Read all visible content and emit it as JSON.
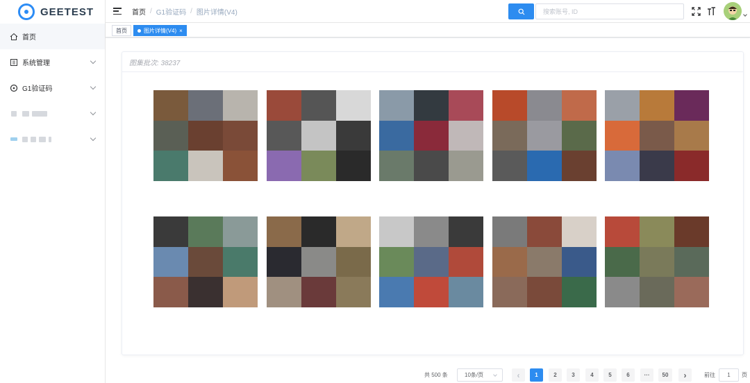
{
  "brand": {
    "name": "GEETEST",
    "color": "#2c8cf5"
  },
  "sidebar": {
    "items": [
      {
        "label": "首页",
        "icon": "home-icon",
        "active": true
      },
      {
        "label": "系统管理",
        "icon": "system-icon",
        "expandable": true
      },
      {
        "label": "G1验证码",
        "icon": "captcha-icon",
        "expandable": true
      },
      {
        "label": "",
        "icon": "blurred-icon",
        "expandable": true
      },
      {
        "label": "",
        "icon": "blurred-icon",
        "expandable": true
      }
    ]
  },
  "header": {
    "breadcrumb": [
      "首页",
      "G1验证码",
      "图片详情(V4)"
    ],
    "search": {
      "placeholder": "搜索账号, ID",
      "value": ""
    }
  },
  "tags": [
    {
      "label": "首页",
      "active": false
    },
    {
      "label": "图片详情(V4)",
      "active": true,
      "closable": "×"
    }
  ],
  "card": {
    "title": "图集批次: 38237"
  },
  "gallery": {
    "sets": [
      {
        "colors": [
          "#7a5a3c",
          "#6b6f78",
          "#b8b4ad",
          "#5a5f55",
          "#6a4030",
          "#7a4a38",
          "#4a7a6c",
          "#c9c4bc",
          "#8a5238"
        ]
      },
      {
        "colors": [
          "#9a4a3a",
          "#555555",
          "#d8d8d8",
          "#585858",
          "#c4c4c4",
          "#3a3a3a",
          "#8a6ab0",
          "#7a8a5a",
          "#2a2a2a"
        ]
      },
      {
        "colors": [
          "#8a9aa8",
          "#333a40",
          "#a84a58",
          "#3a6aa0",
          "#8a2a3a",
          "#c0b8b8",
          "#6a7a6a",
          "#4a4a4a",
          "#9a9a90"
        ]
      },
      {
        "colors": [
          "#b84a2a",
          "#8a8a90",
          "#c06a4a",
          "#7a6a5a",
          "#9a9aa0",
          "#5a6a4a",
          "#5a5a5a",
          "#2a6ab0",
          "#6a4030"
        ]
      },
      {
        "colors": [
          "#9aa0a8",
          "#b87a3a",
          "#6a2a5a",
          "#d86a3a",
          "#7a5a4a",
          "#a87a4a",
          "#7a8ab0",
          "#3a3a4a",
          "#8a2a2a"
        ]
      },
      {
        "colors": [
          "#3a3a3a",
          "#5a7a5a",
          "#8a9a98",
          "#6a8ab0",
          "#6a4a3a",
          "#4a7a6a",
          "#8a5a4a",
          "#3a3030",
          "#c09a7a"
        ]
      },
      {
        "colors": [
          "#8a6a4a",
          "#2a2a2a",
          "#c0a888",
          "#2a2a30",
          "#8a8a88",
          "#7a6a4a",
          "#a09080",
          "#6a3a3a",
          "#8a7a5a"
        ]
      },
      {
        "colors": [
          "#c8c8c8",
          "#8a8a8a",
          "#3a3a3a",
          "#6a8a5a",
          "#5a6a88",
          "#b04a3a",
          "#4a7ab0",
          "#c04a3a",
          "#6a8aa0"
        ]
      },
      {
        "colors": [
          "#7a7a7a",
          "#8a4a3a",
          "#d8d0c8",
          "#9a6a4a",
          "#8a7a6a",
          "#3a5a8a",
          "#8a6a5a",
          "#7a4a3a",
          "#3a6a4a"
        ]
      },
      {
        "colors": [
          "#b84a3a",
          "#8a8a5a",
          "#6a3a2a",
          "#4a6a4a",
          "#7a7a5a",
          "#5a6a5a",
          "#8a8a8a",
          "#6a6a5a",
          "#9a6a5a"
        ]
      }
    ]
  },
  "pagination": {
    "total": "共 500 条",
    "page_size": "10条/页",
    "prev": "‹",
    "next": "›",
    "pages": [
      "1",
      "2",
      "3",
      "4",
      "5",
      "6",
      "···",
      "50"
    ],
    "current": "1",
    "jump_label": "前往",
    "jump_value": "1",
    "page_unit": "页"
  },
  "colors": {
    "accent": "#2d8cf0"
  }
}
